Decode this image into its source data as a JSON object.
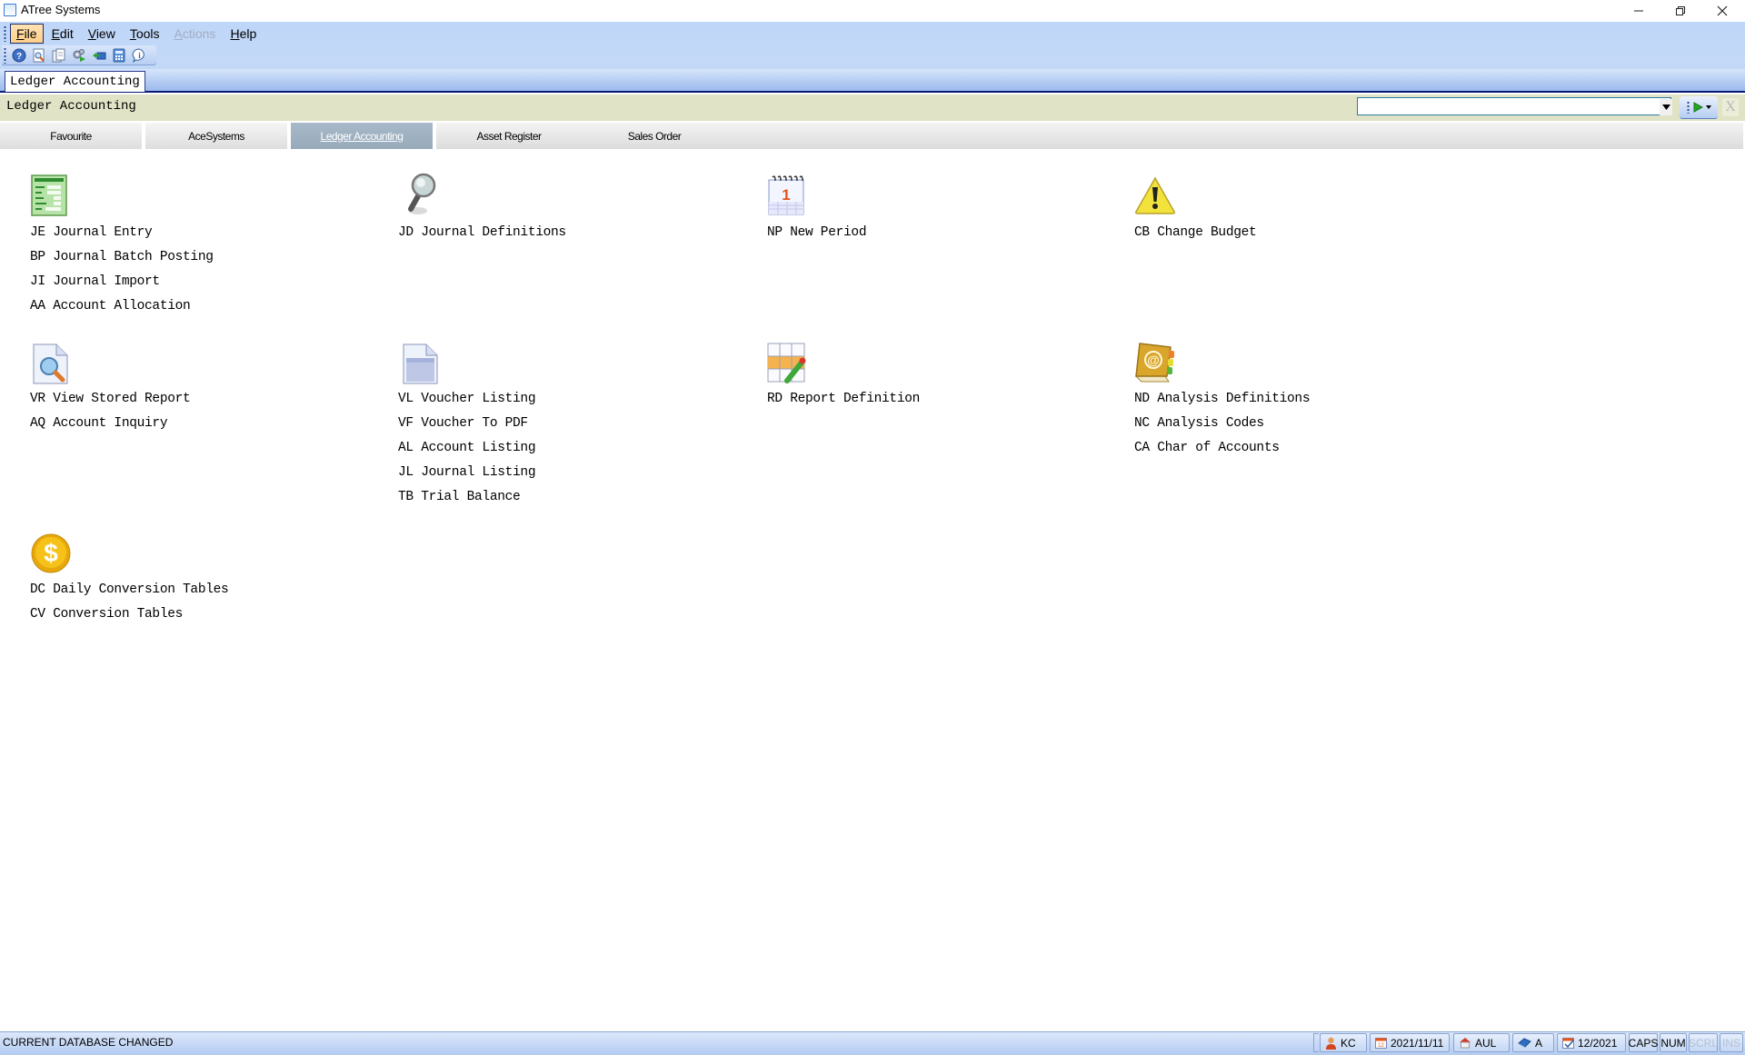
{
  "window": {
    "title": "ATree Systems",
    "controls": [
      "minimize-icon",
      "restore-icon",
      "close-icon"
    ]
  },
  "menubar": {
    "items": [
      {
        "label": "File",
        "accel": "F",
        "state": "active"
      },
      {
        "label": "Edit",
        "accel": "E",
        "state": "normal"
      },
      {
        "label": "View",
        "accel": "V",
        "state": "normal"
      },
      {
        "label": "Tools",
        "accel": "T",
        "state": "normal"
      },
      {
        "label": "Actions",
        "accel": "A",
        "state": "disabled"
      },
      {
        "label": "Help",
        "accel": "H",
        "state": "normal"
      }
    ]
  },
  "toolbar": {
    "buttons": [
      "help-icon",
      "print-preview-icon",
      "copy-document-icon",
      "settings-run-icon",
      "switch-database-icon",
      "calculator-icon",
      "info-icon"
    ]
  },
  "doc_tab": {
    "label": "Ledger Accounting"
  },
  "ledger_header": {
    "title": "Ledger Accounting",
    "search": {
      "value": "",
      "placeholder": ""
    },
    "close_label": "X"
  },
  "module_tabs": [
    {
      "label": "Favourite",
      "active": false
    },
    {
      "label": "AceSystems",
      "active": false
    },
    {
      "label": "Ledger Accounting",
      "active": true
    },
    {
      "label": "Asset Register",
      "active": false
    },
    {
      "label": "Sales Order",
      "active": false
    }
  ],
  "groups": [
    {
      "icon": "journal-form-icon",
      "items": [
        "JE Journal Entry",
        "BP Journal Batch Posting",
        "JI Journal Import",
        "AA Account Allocation"
      ]
    },
    {
      "icon": "magnifier-icon",
      "items": [
        "JD Journal Definitions"
      ]
    },
    {
      "icon": "calendar-icon",
      "items": [
        "NP New Period"
      ]
    },
    {
      "icon": "warning-icon",
      "items": [
        "CB Change Budget"
      ]
    },
    {
      "icon": "document-search-icon",
      "items": [
        "VR View Stored Report",
        "AQ Account Inquiry"
      ]
    },
    {
      "icon": "document-icon",
      "items": [
        "VL Voucher Listing",
        "VF Voucher To PDF",
        "AL Account Listing",
        "JL Journal Listing",
        "TB Trial Balance"
      ]
    },
    {
      "icon": "grid-edit-icon",
      "items": [
        "RD Report Definition"
      ]
    },
    {
      "icon": "address-book-icon",
      "items": [
        "ND Analysis Definitions",
        "NC Analysis Codes",
        "CA Char of Accounts"
      ]
    },
    {
      "icon": "dollar-coin-icon",
      "items": [
        "DC Daily Conversion Tables",
        "CV Conversion Tables"
      ]
    }
  ],
  "statusbar": {
    "message": "CURRENT DATABASE CHANGED",
    "user": "KC",
    "date": "2021/11/11",
    "company": "AUL",
    "ledger": "A",
    "period": "12/2021",
    "caps": "CAPS",
    "num": "NUM",
    "scrl": "SCRL",
    "ins": "INS"
  },
  "colors": {
    "menubar_bg": "#bed6f8",
    "ledger_header_bg": "#e0e3c5",
    "active_tab_bg": "#9fb1c2",
    "statusbar_bg": "#c5d7f4"
  }
}
